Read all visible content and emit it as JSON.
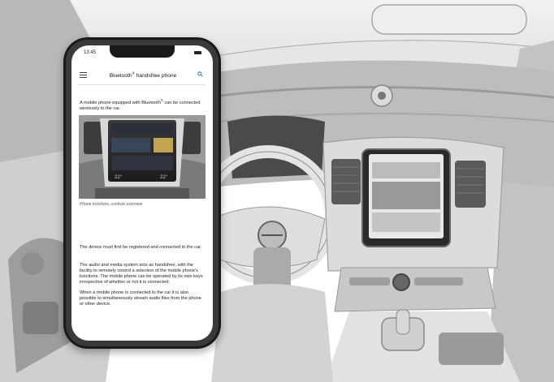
{
  "phone": {
    "status_time": "13:45",
    "title_main": "Bluetooth",
    "title_sup": "®",
    "title_rest": " handsfree phone",
    "intro_pre": "A mobile phone equipped with Bluetooth",
    "intro_sup": "®",
    "intro_post": " can be connected wirelessly to the car.",
    "figure_caption": "Phone functions, controls overview",
    "figure_screen_temp_left": "22°",
    "figure_screen_temp_right": "22°",
    "paragraphs": [
      "The device must first be registered and connected to the car.",
      "The audio and media system acts as handsfree, with the facility to remotely control a selection of the mobile phone's functions. The mobile phone can be operated by its own keys irrespective of whether or not it is connected.",
      "When a mobile phone is connected to the car it is also possible to simultaneously stream audio files from the phone or other device."
    ]
  },
  "icons": [
    "menu-icon",
    "search-icon",
    "volvo-logo-icon"
  ],
  "colors": {
    "background": "#ffffff",
    "interior": "#c9c9c9",
    "phone_frame": "#1a1a1a"
  }
}
